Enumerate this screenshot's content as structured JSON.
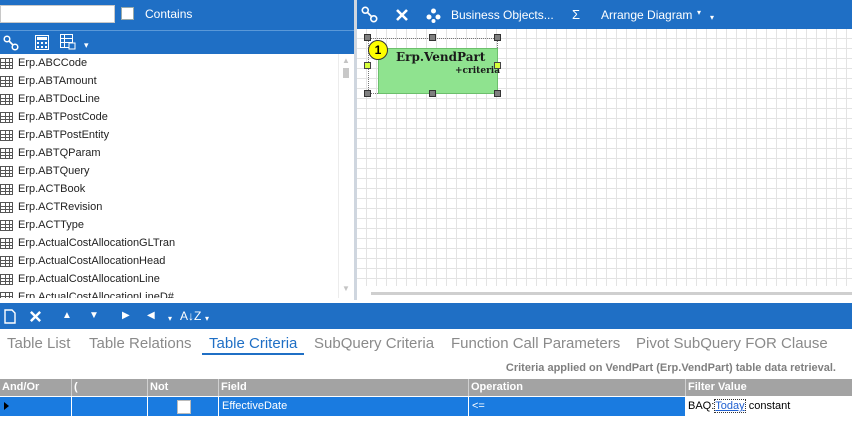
{
  "search": {
    "value": "",
    "contains_label": "Contains"
  },
  "left_toolbar": {
    "icons": [
      "link-icon",
      "calculator-icon",
      "table-grid-icon",
      "dropdown-arrow-icon"
    ]
  },
  "table_list": [
    "Erp.ABCCode",
    "Erp.ABTAmount",
    "Erp.ABTDocLine",
    "Erp.ABTPostCode",
    "Erp.ABTPostEntity",
    "Erp.ABTQParam",
    "Erp.ABTQuery",
    "Erp.ACTBook",
    "Erp.ACTRevision",
    "Erp.ACTType",
    "Erp.ActualCostAllocationGLTran",
    "Erp.ActualCostAllocationHead",
    "Erp.ActualCostAllocationLine",
    "Erp.ActualCostAllocationLineD#"
  ],
  "diagram_toolbar": {
    "business_objects": "Business Objects...",
    "sigma": "Σ",
    "arrange_diagram": "Arrange Diagram",
    "dropdown_arrow": "▾"
  },
  "diagram": {
    "entity": {
      "badge": "1",
      "title": "Erp.VendPart",
      "subtitle": "+criteria"
    }
  },
  "bottom_toolbar": {
    "sort_label": "A↓Z"
  },
  "tabs": [
    {
      "label": "Table List",
      "active": false
    },
    {
      "label": "Table Relations",
      "active": false
    },
    {
      "label": "Table Criteria",
      "active": true
    },
    {
      "label": "SubQuery Criteria",
      "active": false
    },
    {
      "label": "Function Call Parameters",
      "active": false
    },
    {
      "label": "Pivot SubQuery FOR Clause",
      "active": false
    }
  ],
  "criteria_caption": "Criteria applied on VendPart (Erp.VendPart)  table data retrieval.",
  "criteria_grid": {
    "columns": [
      "And/Or",
      "(",
      "Not",
      "Field",
      "Operation",
      "Filter Value"
    ],
    "rows": [
      {
        "and_or": "",
        "paren": "",
        "not": false,
        "field": "EffectiveDate",
        "operation": "<=",
        "filter_prefix": "BAQ:",
        "filter_link": "Today",
        "filter_suffix": "constant"
      }
    ]
  },
  "colors": {
    "toolbar": "#1f6fc5",
    "entity": "#8fe38f",
    "badge": "#ffff00",
    "row_selected": "#1a7be0",
    "header": "#a3a3a3"
  }
}
